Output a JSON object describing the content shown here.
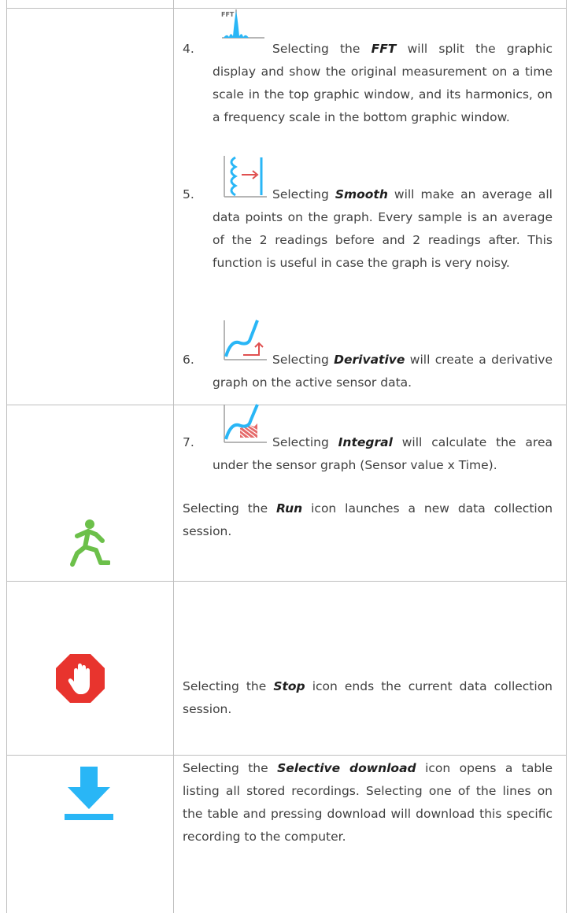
{
  "items": [
    {
      "number": "4.",
      "icon": "fft-icon",
      "icon_label": "FFT",
      "pre": "Selecting the ",
      "keyword": "FFT",
      "post": " will split the graphic display and show the original measurement on a time scale in the top graphic window, and its harmonics, on a frequency scale in the bottom graphic window."
    },
    {
      "number": "5.",
      "icon": "smooth-icon",
      "pre": "Selecting ",
      "keyword": "Smooth",
      "post": " will make an average all data points on the graph. Every sample is an average of the 2 readings before and 2 readings after. This function is useful in case the graph is very noisy."
    },
    {
      "number": "6.",
      "icon": "derivative-icon",
      "pre": "Selecting ",
      "keyword": "Derivative",
      "post": " will create a derivative graph on the active sensor data."
    },
    {
      "number": "7.",
      "icon": "integral-icon",
      "pre": "Selecting ",
      "keyword": "Integral",
      "post": " will calculate the area under the sensor graph (Sensor value x Time)."
    }
  ],
  "rows": [
    {
      "icon": "run-icon",
      "pre": "Selecting the ",
      "keyword": "Run",
      "post": " icon launches a new data collection session."
    },
    {
      "icon": "stop-icon",
      "pre": "Selecting the ",
      "keyword": "Stop",
      "post": " icon ends the current data collection session."
    },
    {
      "icon": "download-icon",
      "pre": "Selecting the ",
      "keyword": "Selective download",
      "post": " icon opens a table listing all stored recordings. Selecting one of the lines on the table and pressing download will download this specific recording to the computer."
    }
  ],
  "colors": {
    "icon_blue": "#29b6f6",
    "run_green": "#6cc04a",
    "stop_red": "#e8342e",
    "arrow_red": "#e05050",
    "border": "#bfbfbf"
  }
}
